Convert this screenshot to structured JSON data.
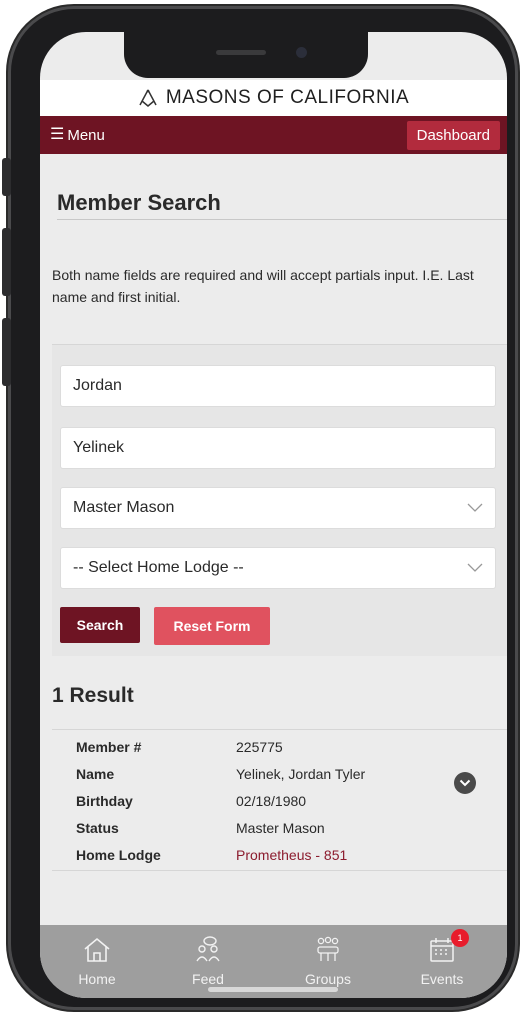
{
  "brand": {
    "name": "MASONS OF CALIFORNIA",
    "icon": "square-and-compass-icon"
  },
  "navbar": {
    "menu_label": "Menu",
    "menu_icon": "hamburger-icon",
    "dashboard_label": "Dashboard"
  },
  "page": {
    "title": "Member Search",
    "info": "Both name fields are required and will accept partials input. I.E. Last name and first initial."
  },
  "form": {
    "first_name_value": "Jordan",
    "last_name_value": "Yelinek",
    "status_selected": "Master Mason",
    "lodge_selected": "-- Select Home Lodge --",
    "search_label": "Search",
    "reset_label": "Reset Form"
  },
  "results": {
    "count_label": "1 Result",
    "items": [
      {
        "fields": [
          {
            "label": "Member #",
            "value": "225775"
          },
          {
            "label": "Name",
            "value": "Yelinek, Jordan Tyler"
          },
          {
            "label": "Birthday",
            "value": "02/18/1980"
          },
          {
            "label": "Status",
            "value": "Master Mason"
          },
          {
            "label": "Home Lodge",
            "value": "Prometheus - 851"
          }
        ]
      }
    ]
  },
  "tabbar": {
    "items": [
      {
        "label": "Home",
        "icon": "home-icon"
      },
      {
        "label": "Feed",
        "icon": "feed-icon"
      },
      {
        "label": "Groups",
        "icon": "groups-icon"
      },
      {
        "label": "Events",
        "icon": "calendar-icon",
        "badge": "1"
      }
    ]
  },
  "colors": {
    "primary": "#6e1423",
    "accent": "#b22b3d",
    "reset": "#e0525f",
    "link": "#8c1c2e",
    "tabbar": "#9e9e9e"
  }
}
